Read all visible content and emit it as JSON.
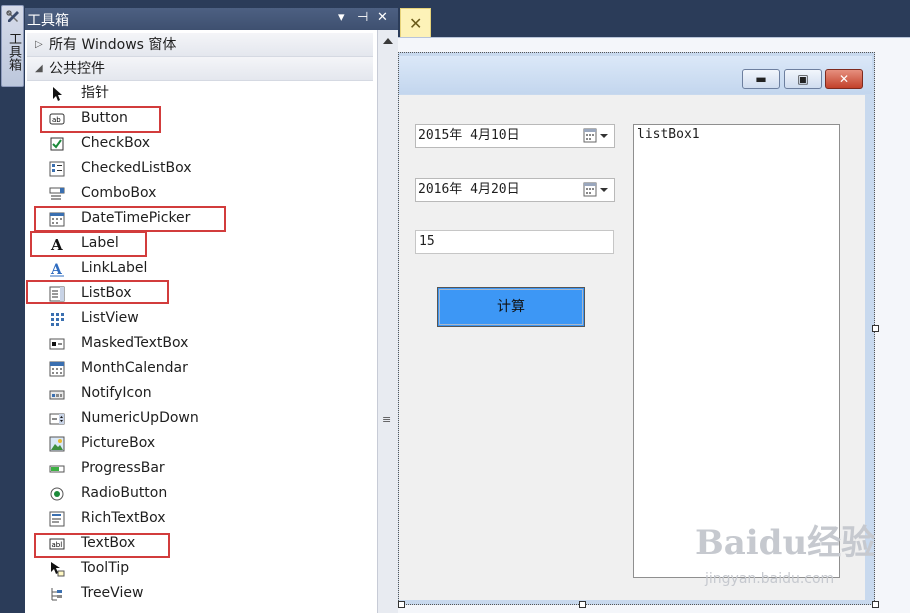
{
  "dock": {
    "tab_label": "工具箱",
    "icon": "tools-icon"
  },
  "toolbox": {
    "title": "工具箱",
    "controls": {
      "dropdown": "▾",
      "pin": "⊣",
      "close": "✕"
    },
    "categories": [
      {
        "label": "所有 Windows 窗体",
        "expanded": false
      },
      {
        "label": "公共控件",
        "expanded": true
      }
    ],
    "items": [
      {
        "label": "指针",
        "icon": "pointer-icon",
        "highlighted": false
      },
      {
        "label": "Button",
        "icon": "button-icon",
        "highlighted": true
      },
      {
        "label": "CheckBox",
        "icon": "checkbox-icon",
        "highlighted": false
      },
      {
        "label": "CheckedListBox",
        "icon": "checkedlistbox-icon",
        "highlighted": false
      },
      {
        "label": "ComboBox",
        "icon": "combobox-icon",
        "highlighted": false
      },
      {
        "label": "DateTimePicker",
        "icon": "datetimepicker-icon",
        "highlighted": true
      },
      {
        "label": "Label",
        "icon": "label-icon",
        "highlighted": true
      },
      {
        "label": "LinkLabel",
        "icon": "linklabel-icon",
        "highlighted": false
      },
      {
        "label": "ListBox",
        "icon": "listbox-icon",
        "highlighted": true
      },
      {
        "label": "ListView",
        "icon": "listview-icon",
        "highlighted": false
      },
      {
        "label": "MaskedTextBox",
        "icon": "maskedtextbox-icon",
        "highlighted": false
      },
      {
        "label": "MonthCalendar",
        "icon": "monthcalendar-icon",
        "highlighted": false
      },
      {
        "label": "NotifyIcon",
        "icon": "notifyicon-icon",
        "highlighted": false
      },
      {
        "label": "NumericUpDown",
        "icon": "numericupdown-icon",
        "highlighted": false
      },
      {
        "label": "PictureBox",
        "icon": "picturebox-icon",
        "highlighted": false
      },
      {
        "label": "ProgressBar",
        "icon": "progressbar-icon",
        "highlighted": false
      },
      {
        "label": "RadioButton",
        "icon": "radiobutton-icon",
        "highlighted": false
      },
      {
        "label": "RichTextBox",
        "icon": "richtextbox-icon",
        "highlighted": false
      },
      {
        "label": "TextBox",
        "icon": "textbox-icon",
        "highlighted": true
      },
      {
        "label": "ToolTip",
        "icon": "tooltip-icon",
        "highlighted": false
      },
      {
        "label": "TreeView",
        "icon": "treeview-icon",
        "highlighted": false
      }
    ],
    "highlight_color": "#d23c3c"
  },
  "editor_tab": {
    "close": "✕"
  },
  "form": {
    "window_buttons": {
      "minimize": "▬",
      "maximize": "▣",
      "close": "✕"
    },
    "date1": "2015年 4月10日",
    "date2": "2016年 4月20日",
    "textbox_value": "15",
    "button_label": "计算",
    "button_color": "#3d97f5",
    "listbox_label": "listBox1"
  },
  "watermark": {
    "brand": "Baidu经验",
    "url": "jingyan.baidu.com"
  }
}
